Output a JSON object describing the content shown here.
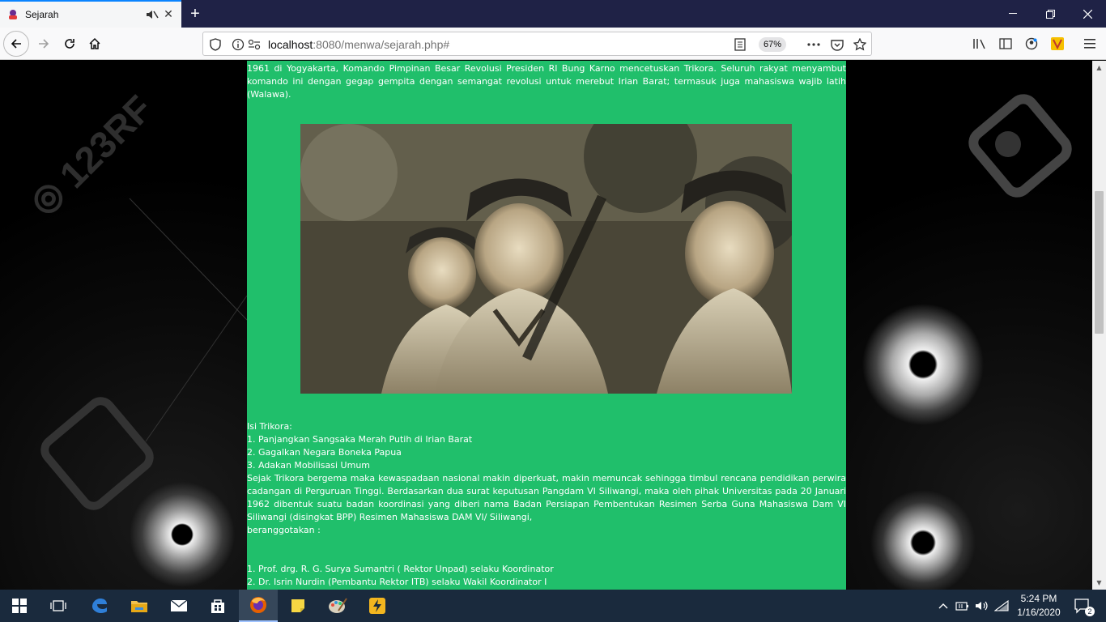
{
  "browser": {
    "tab_title": "Sejarah",
    "newtab_label": "+",
    "url_host": "localhost",
    "url_rest": ":8080/menwa/sejarah.php#",
    "zoom": "67%"
  },
  "page": {
    "intro_lines": [
      "1961 di Yogyakarta, Komando Pimpinan Besar Revolusi Presiden RI Bung Karno mencetuskan Trikora. Seluruh rakyat menyambut komando ini dengan gegap gempita dengan semangat revolusi untuk merebut Irian Barat; termasuk juga mahasiswa wajib latih (Walawa)."
    ],
    "photo_alt": "photo of student soldiers in uniform",
    "trikora_heading": "Isi Trikora:",
    "trikora_items": [
      "1. Panjangkan Sangsaka Merah Putih di Irian Barat",
      "2. Gagalkan Negara Boneka Papua",
      "3. Adakan Mobilisasi Umum"
    ],
    "body_paragraph": "Sejak Trikora bergema maka kewaspadaan nasional makin diperkuat, makin memuncak sehingga timbul rencana pendidikan perwira cadangan di Perguruan Tinggi. Berdasarkan dua surat keputusan Pangdam VI Siliwangi, maka oleh pihak Universitas pada 20 Januari 1962 dibentuk suatu badan koordinasi yang diberi nama Badan Persiapan Pembentukan Resimen Serba Guna Mahasiswa Dam VI Siliwangi (disingkat BPP) Resimen Mahasiswa DAM VI/ Siliwangi,",
    "members_label": "beranggotakan :",
    "members": [
      "1. Prof. drg. R. G. Surya Sumantri ( Rektor Unpad) selaku Koordinator",
      "2. Dr. Isrin Nurdin (Pembantu Rektor ITB) selaku Wakil Koordinator I"
    ]
  },
  "taskbar": {
    "time": "5:24 PM",
    "date": "1/16/2020",
    "notification_count": "2"
  },
  "colors": {
    "content_bg": "#20bf6b",
    "tab_accent": "#0a84ff",
    "taskbar_bg": "#1a2a3d"
  }
}
